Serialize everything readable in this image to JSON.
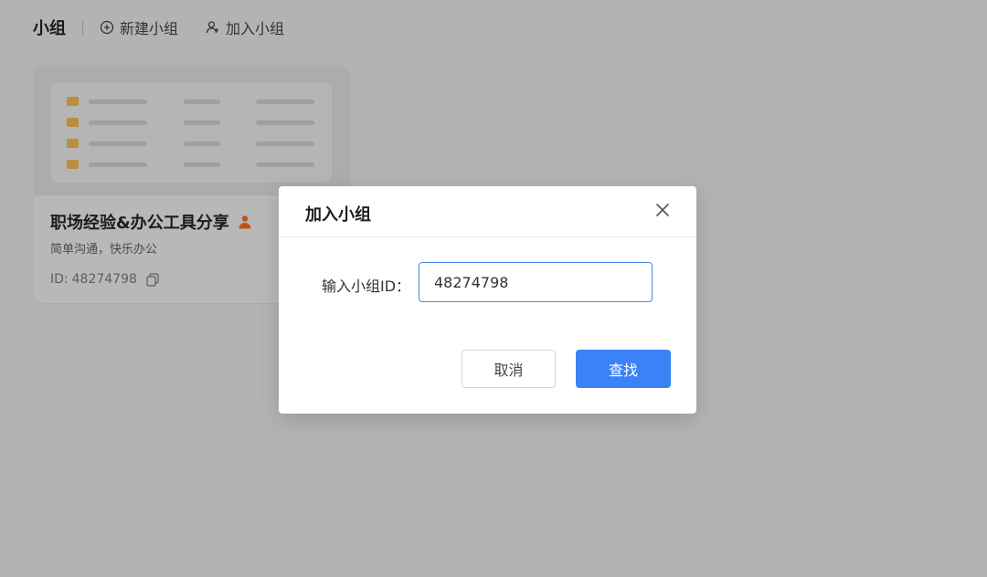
{
  "toolbar": {
    "title": "小组",
    "actions": [
      {
        "label": "新建小组",
        "icon": "plus-circle-icon"
      },
      {
        "label": "加入小组",
        "icon": "user-add-icon"
      }
    ]
  },
  "card": {
    "name": "职场经验&办公工具分享",
    "owner_icon": "owner-user-icon",
    "description": "简单沟通，快乐办公",
    "id_label": "ID:",
    "id_value": "48274798",
    "copy_icon": "copy-icon"
  },
  "modal": {
    "title": "加入小组",
    "close_icon": "close-icon",
    "field_label": "输入小组ID：",
    "input_value": "48274798",
    "cancel_label": "取消",
    "search_label": "查找"
  },
  "colors": {
    "overlay_background": "#b3b3b3",
    "primary": "#3b82f6",
    "input_border": "#4b87e6",
    "folder": "#b98e3d",
    "owner_icon": "#c0521f"
  }
}
